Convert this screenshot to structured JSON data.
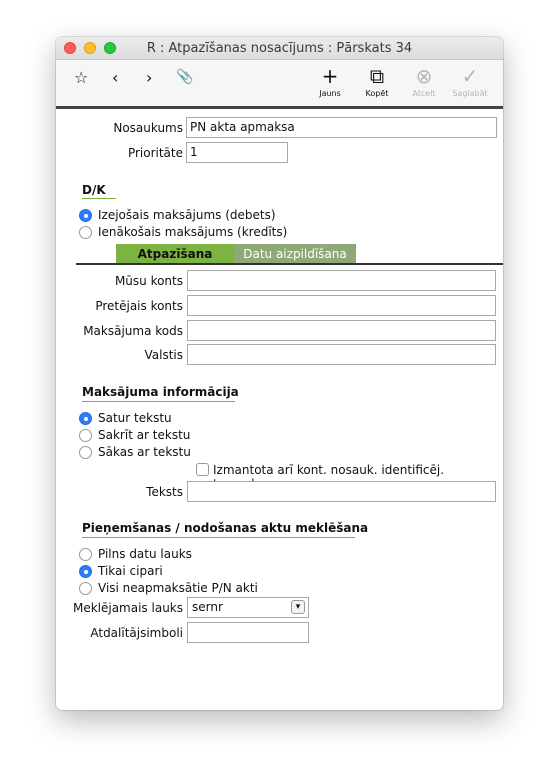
{
  "window": {
    "title": "R : Atpazīšanas nosacījums : Pārskats 34"
  },
  "toolbar": {
    "jauns": "Jauns",
    "kopet": "Kopēt",
    "atcelt": "Atcelt",
    "saglabat": "Saglabāt"
  },
  "form": {
    "nosaukums_label": "Nosaukums",
    "nosaukums_value": "PN akta apmaksa",
    "prioritate_label": "Prioritāte",
    "prioritate_value": "1"
  },
  "dk": {
    "title": "D/K",
    "options": [
      "Izejošais maksājums (debets)",
      "Ienākošais maksājums (kredīts)"
    ],
    "selected": 0
  },
  "tabs": {
    "active": "Atpazīšana",
    "inactive": "Datu aizpildīšana"
  },
  "recognition": {
    "musu_konts": "Mūsu konts",
    "pretejais_konts": "Pretējais konts",
    "maksajuma_kods": "Maksājuma kods",
    "valstis": "Valstis"
  },
  "payment_info": {
    "title": "Maksājuma informācija",
    "options": [
      "Satur tekstu",
      "Sakrīt ar tekstu",
      "Sākas ar tekstu"
    ],
    "selected": 0,
    "checkbox_label": "Izmantota arī kont. nosauk. identificēj. transakc.",
    "teksts_label": "Teksts"
  },
  "acts": {
    "title": "Pieņemšanas / nodošanas aktu meklēšana",
    "options": [
      "Pilns datu lauks",
      "Tikai cipari",
      "Visi neapmaksātie P/N akti"
    ],
    "selected": 1,
    "search_field_label": "Meklējamais lauks",
    "search_field_value": "sernr",
    "separators_label": "Atdalītājsimboli"
  }
}
